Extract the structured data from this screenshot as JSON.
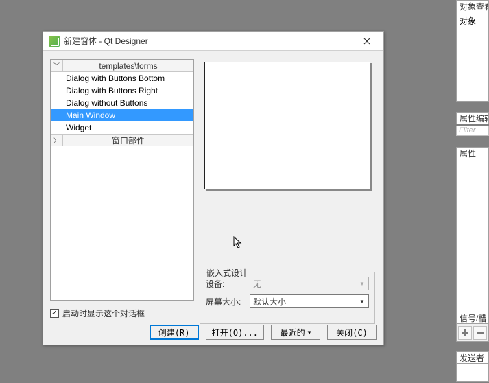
{
  "dialog": {
    "title": "新建窗体 - Qt Designer",
    "tree": {
      "header_label": "templates\\forms",
      "items": [
        "Dialog with Buttons Bottom",
        "Dialog with Buttons Right",
        "Dialog without Buttons",
        "Main Window",
        "Widget"
      ],
      "selected_index": 3,
      "sub_header": "窗口部件"
    },
    "embedded": {
      "group_title": "嵌入式设计",
      "device_label": "设备:",
      "device_value": "无",
      "screen_label": "屏幕大小:",
      "screen_value": "默认大小"
    },
    "startup_checkbox": {
      "label": "启动时显示这个对话框",
      "checked": true
    },
    "buttons": {
      "create": "创建(R)",
      "open": "打开(O)...",
      "recent": "最近的",
      "close": "关闭(C)"
    }
  },
  "panels": {
    "object_inspector_title": "对象查看",
    "object_label": "对象",
    "property_editor_title": "属性编辑",
    "filter_placeholder": "Filter",
    "property_label": "属性",
    "signal_slot_title": "信号/槽",
    "sender_label": "发送者"
  }
}
